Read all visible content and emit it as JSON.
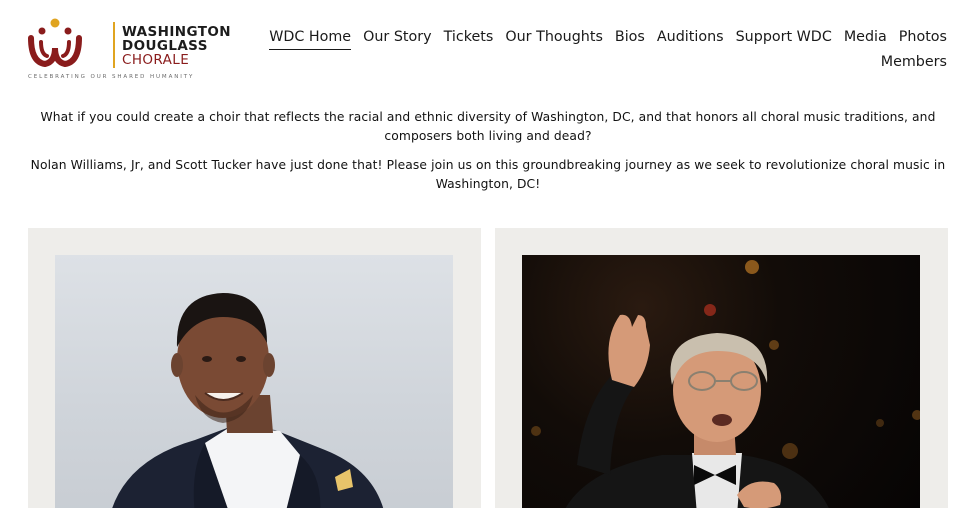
{
  "logo": {
    "line1": "WASHINGTON",
    "line2": "DOUGLASS",
    "line3": "CHORALE",
    "tagline": "CELEBRATING OUR SHARED HUMANITY"
  },
  "nav": {
    "row1": [
      "WDC Home",
      "Our Story",
      "Tickets",
      "Our Thoughts",
      "Bios",
      "Auditions",
      "Support WDC",
      "Media",
      "Photos"
    ],
    "row2": [
      "Members"
    ],
    "active": "WDC Home"
  },
  "intro": {
    "p1": "What if you could create a choir that reflects the racial and ethnic diversity of Washington, DC, and that honors all choral music traditions, and composers both living and dead?",
    "p2": "Nolan Williams, Jr, and Scott Tucker have just done that! Please join us on this groundbreaking journey as we seek to revolutionize choral music in Washington, DC!"
  },
  "colors": {
    "brand_red": "#8a1c1c",
    "brand_gold": "#e0a420",
    "card_bg": "#eeedea"
  }
}
